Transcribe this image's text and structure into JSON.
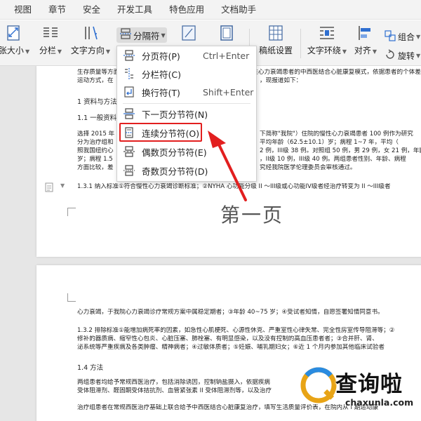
{
  "ribbon": {
    "tabs": [
      "视图",
      "章节",
      "安全",
      "开发工具",
      "特色应用",
      "文档助手"
    ]
  },
  "toolbar": {
    "paper_size": "张大小",
    "columns": "分栏",
    "text_direction": "文字方向",
    "break_label": "分隔符",
    "draft_settings": "稿纸设置",
    "text_wrap": "文字环绕",
    "align": "对齐",
    "group": "组合",
    "rotate": "旋转"
  },
  "break_menu": {
    "items": [
      {
        "label": "分页符(P)",
        "shortcut": "Ctrl+Enter",
        "icon": "page-break-icon"
      },
      {
        "label": "分栏符(C)",
        "shortcut": "",
        "icon": "column-break-icon"
      },
      {
        "label": "换行符(T)",
        "shortcut": "Shift+Enter",
        "icon": "line-break-icon"
      },
      {
        "label": "下一页分节符(N)",
        "shortcut": "",
        "icon": "next-page-section-icon"
      },
      {
        "label": "连续分节符(O)",
        "shortcut": "",
        "icon": "continuous-section-icon"
      },
      {
        "label": "偶数页分节符(E)",
        "shortcut": "",
        "icon": "even-page-section-icon"
      },
      {
        "label": "奇数页分节符(D)",
        "shortcut": "",
        "icon": "odd-page-section-icon"
      }
    ],
    "highlighted_index": 4,
    "highlight_color": "#e21f1f"
  },
  "document": {
    "page1": {
      "lines": [
        "生存质量等方面的影响，以期为临床治疗提供科学依据，为改善慢性心力衰竭患者的中西医结合心脏康复模式，依据患者的个体差",
        "运动方式，在",
        "1 资料与方法",
        "1.1 一般资料",
        "选择 2015 年",
        "分为治疗组和",
        "照我国纽约心",
        "岁；病程 1.5",
        "方面比较，差",
        "1.3.1 纳入标准①符合慢性心力衰竭诊断标准；②NYHA 心功能分级 II ～III级或心功能IV级者经治疗转变为 II ～III级者"
      ],
      "lines_right": [
        "，现报道如下：",
        "下简称\"我院\"）住院的慢性心力衰竭患者 100 例作为研究",
        "平均年龄（62.5±10.1）岁；病程 1~7 年，平均（",
        "2 例，III级 38 例。对照组 50 例，男 29 例，女 21 例，年龄",
        "，II级 10 例，III级 40 例。两组患者性别、年龄、病程",
        "究经我院医学伦理委员会审核通过。"
      ],
      "title": "第一页"
    },
    "page2": {
      "lines": [
        "心力衰竭，于我院心力衰竭诊疗常规方案中属稳定期者；③年龄 40~75 岁；④受试者知情，自愿签署知情同意书。",
        "1.3.2 排除标准①能增加病死率的因素，如急性心肌梗死、心源性休克、严重室性心律失常、完全性房室传导阻滞等；②",
        "修补的器质病、缩窄性心包炎、心脏压塞、肺栓塞、有明显感染，以及没有控制的高血压患者者；③合并肝、肾、",
        "泌系统等严重疾病及各类肿瘤、精神病者；④过敏体质者；⑤妊娠、哺乳期妇女；⑥近 1 个月内参加其他临床试验者",
        "1.4 方法",
        "两组患者均给予常规西医治疗，包括消除诱因，控制钠盐摄入，依据疾病",
        "受体阻滞剂、醛固酮受体拮抗剂、血管紧张素 II 受体阻滞剂等，以及治疗",
        "治疗组患者在常规西医治疗基础上联合给予中西医结合心脏康复治疗，填写生活质量评价表，在院内从 I 期运动康"
      ]
    }
  },
  "watermark": {
    "brand_cn": "查询啦",
    "brand_url": "chaxunla.com"
  },
  "colors": {
    "accent_red": "#e21f1f",
    "ribbon_bg": "#f3f3f3",
    "canvas_bg": "#e6e6e6"
  }
}
